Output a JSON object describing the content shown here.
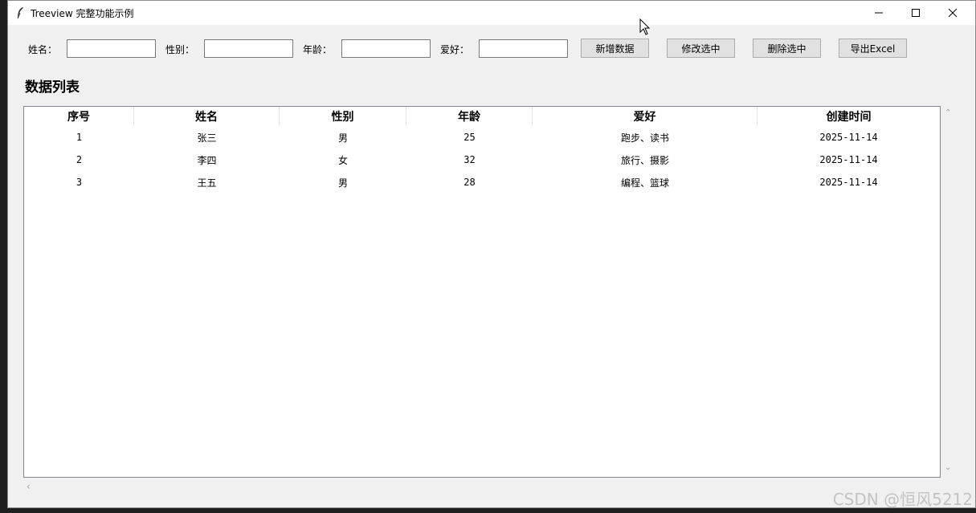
{
  "window": {
    "title": "Treeview 完整功能示例"
  },
  "form": {
    "name_label": "姓名：",
    "gender_label": "性别：",
    "age_label": "年龄：",
    "hobby_label": "爱好：",
    "name_value": "",
    "gender_value": "",
    "age_value": "",
    "hobby_value": ""
  },
  "toolbar": {
    "add_label": "新增数据",
    "edit_label": "修改选中",
    "delete_label": "删除选中",
    "export_label": "导出Excel"
  },
  "section": {
    "title": "数据列表"
  },
  "table": {
    "columns": [
      "序号",
      "姓名",
      "性别",
      "年龄",
      "爱好",
      "创建时间"
    ],
    "rows": [
      [
        "1",
        "张三",
        "男",
        "25",
        "跑步、读书",
        "2025-11-14"
      ],
      [
        "2",
        "李四",
        "女",
        "32",
        "旅行、摄影",
        "2025-11-14"
      ],
      [
        "3",
        "王五",
        "男",
        "28",
        "编程、篮球",
        "2025-11-14"
      ]
    ]
  },
  "watermark": "CSDN @恒风5212"
}
